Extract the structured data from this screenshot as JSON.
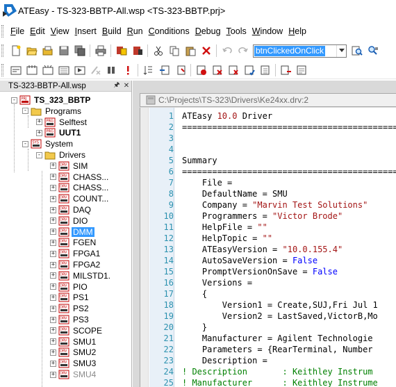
{
  "window": {
    "title": "ATEasy - TS-323-BBTP-All.wsp <TS-323-BBTP.prj>"
  },
  "menu": [
    {
      "label": "File",
      "u": "F",
      "rest": "ile"
    },
    {
      "label": "Edit",
      "u": "E",
      "rest": "dit"
    },
    {
      "label": "View",
      "u": "V",
      "rest": "iew"
    },
    {
      "label": "Insert",
      "u": "I",
      "rest": "nsert"
    },
    {
      "label": "Build",
      "u": "B",
      "rest": "uild"
    },
    {
      "label": "Run",
      "u": "R",
      "rest": "un"
    },
    {
      "label": "Conditions",
      "u": "C",
      "rest": "onditions"
    },
    {
      "label": "Debug",
      "u": "D",
      "rest": "ebug"
    },
    {
      "label": "Tools",
      "u": "T",
      "rest": "ools"
    },
    {
      "label": "Window",
      "u": "W",
      "rest": "indow"
    },
    {
      "label": "Help",
      "u": "H",
      "rest": "elp"
    }
  ],
  "toolbar": {
    "find_value": "btnClickedOnClick"
  },
  "workspace": {
    "panel_title": "TS-323-BBTP-All.wsp",
    "project": "TS_323_BBTP",
    "programs_folder": "Programs",
    "programs": [
      "Selftest",
      "UUT1"
    ],
    "system": "System",
    "drivers_folder": "Drivers",
    "drivers": [
      "SIM",
      "CHASS...",
      "CHASS...",
      "COUNT...",
      "DAQ",
      "DIO",
      "DMM",
      "FGEN",
      "FPGA1",
      "FPGA2",
      "MILSTD1.",
      "PIO",
      "PS1",
      "PS2",
      "PS3",
      "SCOPE",
      "SMU1",
      "SMU2",
      "SMU3",
      "SMU4"
    ],
    "selected_driver": "DMM"
  },
  "document": {
    "path": "C:\\Projects\\TS-323\\Drivers\\Ke24xx.drv:2",
    "lines": [
      {
        "n": "1",
        "code": "ATEasy 10.0 Driver"
      },
      {
        "n": "2",
        "code": "==============================================="
      },
      {
        "n": "3",
        "code": ""
      },
      {
        "n": "4",
        "code": ""
      },
      {
        "n": "5",
        "code": "Summary"
      },
      {
        "n": "6",
        "code": "==============================================="
      },
      {
        "n": "7",
        "code": "    File ="
      },
      {
        "n": "8",
        "code": "    DefaultName = SMU"
      },
      {
        "n": "9",
        "code": "    Company = \"Marvin Test Solutions\""
      },
      {
        "n": "10",
        "code": "    Programmers = \"Victor Brode\""
      },
      {
        "n": "11",
        "code": "    HelpFile = \"\""
      },
      {
        "n": "12",
        "code": "    HelpTopic = \"\""
      },
      {
        "n": "13",
        "code": "    ATEasyVersion = \"10.0.155.4\""
      },
      {
        "n": "14",
        "code": "    AutoSaveVersion = False"
      },
      {
        "n": "15",
        "code": "    PromptVersionOnSave = False"
      },
      {
        "n": "16",
        "code": "    Versions ="
      },
      {
        "n": "17",
        "code": "    {"
      },
      {
        "n": "18",
        "code": "        Version1 = Create,SUJ,Fri Jul 1"
      },
      {
        "n": "19",
        "code": "        Version2 = LastSaved,VictorB,Mo"
      },
      {
        "n": "20",
        "code": "    }"
      },
      {
        "n": "21",
        "code": "    Manufacturer = Agilent Technologie"
      },
      {
        "n": "22",
        "code": "    Parameters = {RearTerminal, Number"
      },
      {
        "n": "23",
        "code": "    Description ="
      },
      {
        "n": "24",
        "code": "! Description       : Keithley Instrum"
      },
      {
        "n": "25",
        "code": "! Manufacturer      : Keithley Instrume"
      }
    ]
  },
  "colors": {
    "selection": "#3399ff",
    "line_number": "#2b91af",
    "string": "#a31515",
    "keyword": "#0000ff",
    "comment": "#008000"
  }
}
